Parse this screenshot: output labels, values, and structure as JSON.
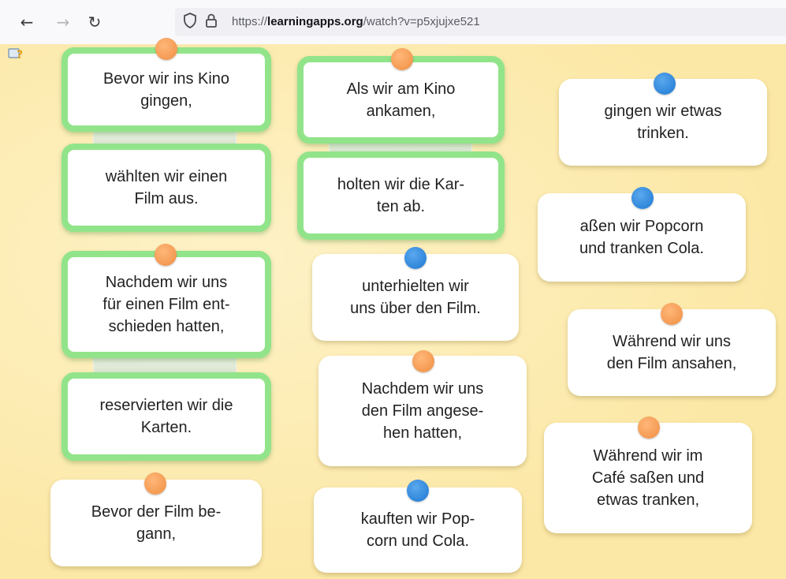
{
  "browser": {
    "back_icon": "arrow-left-icon",
    "forward_icon": "arrow-right-icon",
    "reload_icon": "reload-icon",
    "url_prefix": "https://",
    "url_domain": "learningapps.org",
    "url_path": "/watch?v=p5xjujxe521"
  },
  "colors": {
    "background": "#fce8a6",
    "green_border": "#92e48a",
    "pin_orange": "#f49a52",
    "pin_blue": "#2f86da"
  },
  "cards": [
    {
      "text": "Bevor wir ins Kino\ngingen,",
      "pin": "orange",
      "linked": true
    },
    {
      "text": "wählten wir einen\nFilm aus.",
      "pin": "none",
      "linked": true
    },
    {
      "text": "Nachdem wir uns\nfür einen Film ent-\nschieden hatten,",
      "pin": "orange",
      "linked": true
    },
    {
      "text": "reservierten wir die\nKarten.",
      "pin": "none",
      "linked": true
    },
    {
      "text": "Bevor der Film be-\ngann,",
      "pin": "orange",
      "linked": false
    },
    {
      "text": "Als wir am Kino\nankamen,",
      "pin": "orange",
      "linked": true
    },
    {
      "text": "holten wir die Kar-\nten ab.",
      "pin": "none",
      "linked": true
    },
    {
      "text": "unterhielten wir\nuns über den Film.",
      "pin": "blue",
      "linked": false
    },
    {
      "text": "Nachdem wir uns\nden Film angese-\nhen hatten,",
      "pin": "orange",
      "linked": false
    },
    {
      "text": "kauften wir Pop-\ncorn und Cola.",
      "pin": "blue",
      "linked": false
    },
    {
      "text": "gingen wir etwas\ntrinken.",
      "pin": "blue",
      "linked": false
    },
    {
      "text": "aßen wir Popcorn\nund tranken Cola.",
      "pin": "blue",
      "linked": false
    },
    {
      "text": "Während wir uns\nden Film ansahen,",
      "pin": "orange",
      "linked": false
    },
    {
      "text": "Während wir im\nCafé saßen und\netwas tranken,",
      "pin": "orange",
      "linked": false
    }
  ]
}
